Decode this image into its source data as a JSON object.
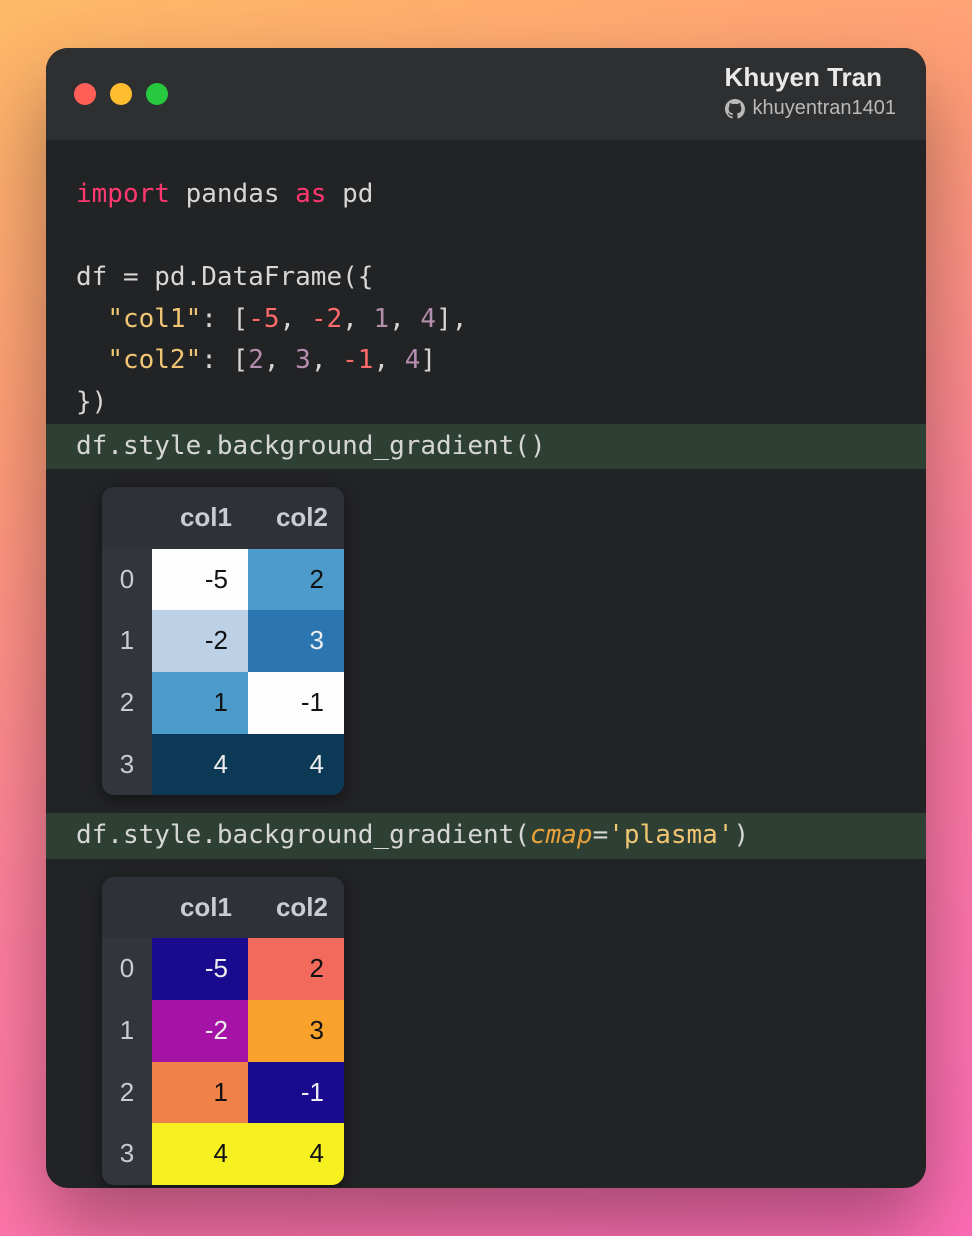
{
  "author": {
    "name": "Khuyen Tran",
    "handle": "khuyentran1401"
  },
  "code": {
    "l1a": "import",
    "l1b": " pandas ",
    "l1c": "as",
    "l1d": " pd",
    "l3": "df = pd.DataFrame({",
    "l4_pre": "  ",
    "l4_key": "\"col1\"",
    "l4_mid": ": [",
    "l4_n1": "-5",
    "l4_n2": "-2",
    "l4_n3": "1",
    "l4_n4": "4",
    "l4_end": "],",
    "l5_pre": "  ",
    "l5_key": "\"col2\"",
    "l5_mid": ": [",
    "l5_n1": "2",
    "l5_n2": "3",
    "l5_n3": "-1",
    "l5_n4": "4",
    "l5_end": "]",
    "l6": "})",
    "l7": "df.style.background_gradient()  ",
    "l8a": "df.style.background_gradient(",
    "l8b": "cmap",
    "l8c": "=",
    "l8d": "'plasma'",
    "l8e": ")"
  },
  "table1": {
    "headers": [
      "col1",
      "col2"
    ],
    "rows": [
      {
        "idx": "0",
        "cells": [
          {
            "v": "-5",
            "bg": "#fdfdfe",
            "dark": true
          },
          {
            "v": "2",
            "bg": "#4c9bcb",
            "dark": true
          }
        ]
      },
      {
        "idx": "1",
        "cells": [
          {
            "v": "-2",
            "bg": "#bcd0e6",
            "dark": true
          },
          {
            "v": "3",
            "bg": "#2b76b0",
            "dark": false
          }
        ]
      },
      {
        "idx": "2",
        "cells": [
          {
            "v": "1",
            "bg": "#4c9bcb",
            "dark": true
          },
          {
            "v": "-1",
            "bg": "#fdfdfe",
            "dark": true
          }
        ]
      },
      {
        "idx": "3",
        "cells": [
          {
            "v": "4",
            "bg": "#0b3956",
            "dark": false
          },
          {
            "v": "4",
            "bg": "#0b3956",
            "dark": false
          }
        ]
      }
    ]
  },
  "table2": {
    "headers": [
      "col1",
      "col2"
    ],
    "rows": [
      {
        "idx": "0",
        "cells": [
          {
            "v": "-5",
            "bg": "#1a0b8e",
            "dark": false
          },
          {
            "v": "2",
            "bg": "#f26a5b",
            "dark": true
          }
        ]
      },
      {
        "idx": "1",
        "cells": [
          {
            "v": "-2",
            "bg": "#a413a6",
            "dark": false
          },
          {
            "v": "3",
            "bg": "#f9a22b",
            "dark": true
          }
        ]
      },
      {
        "idx": "2",
        "cells": [
          {
            "v": "1",
            "bg": "#f08249",
            "dark": true
          },
          {
            "v": "-1",
            "bg": "#1a0b8e",
            "dark": false
          }
        ]
      },
      {
        "idx": "3",
        "cells": [
          {
            "v": "4",
            "bg": "#f7f021",
            "dark": true
          },
          {
            "v": "4",
            "bg": "#f7f021",
            "dark": true
          }
        ]
      }
    ]
  },
  "chart_data": {
    "type": "table",
    "title": "pandas Styler background_gradient examples",
    "dataframe": {
      "index": [
        0,
        1,
        2,
        3
      ],
      "columns": [
        "col1",
        "col2"
      ],
      "data": [
        [
          -5,
          2
        ],
        [
          -2,
          3
        ],
        [
          1,
          -1
        ],
        [
          4,
          4
        ]
      ]
    },
    "views": [
      {
        "call": "df.style.background_gradient()",
        "cmap": "default (PuBu-like)"
      },
      {
        "call": "df.style.background_gradient(cmap='plasma')",
        "cmap": "plasma"
      }
    ]
  }
}
